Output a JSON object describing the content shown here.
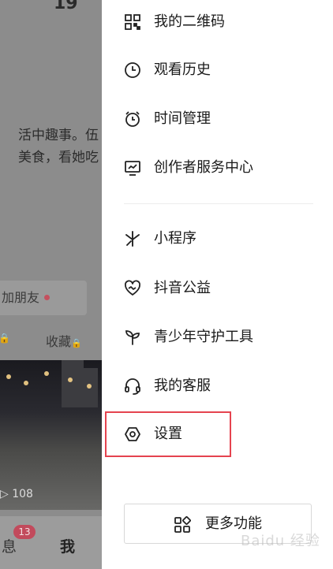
{
  "background_profile": {
    "top_number": "19",
    "bio_lines": [
      "活中趣事。伍",
      "美食，看她吃"
    ],
    "add_friend_label": "加朋友",
    "tab_favorites": "收藏",
    "views": "108",
    "nav_messages_label": "息",
    "nav_messages_badge": "13",
    "nav_me_label": "我"
  },
  "drawer": {
    "items": [
      {
        "label": "我的二维码",
        "icon": "qr-code-icon"
      },
      {
        "label": "观看历史",
        "icon": "clock-icon"
      },
      {
        "label": "时间管理",
        "icon": "alarm-clock-icon"
      },
      {
        "label": "创作者服务中心",
        "icon": "chart-monitor-icon"
      },
      {
        "label": "小程序",
        "icon": "mini-program-icon"
      },
      {
        "label": "抖音公益",
        "icon": "heart-charity-icon"
      },
      {
        "label": "青少年守护工具",
        "icon": "sprout-icon"
      },
      {
        "label": "我的客服",
        "icon": "headset-icon"
      },
      {
        "label": "设置",
        "icon": "hexagon-settings-icon"
      }
    ],
    "more_button_label": "更多功能",
    "more_button_icon": "grid-icon"
  },
  "watermark_text": "Baidu 经验",
  "colors": {
    "highlight": "#e5434f",
    "badge": "#c24a5c"
  }
}
